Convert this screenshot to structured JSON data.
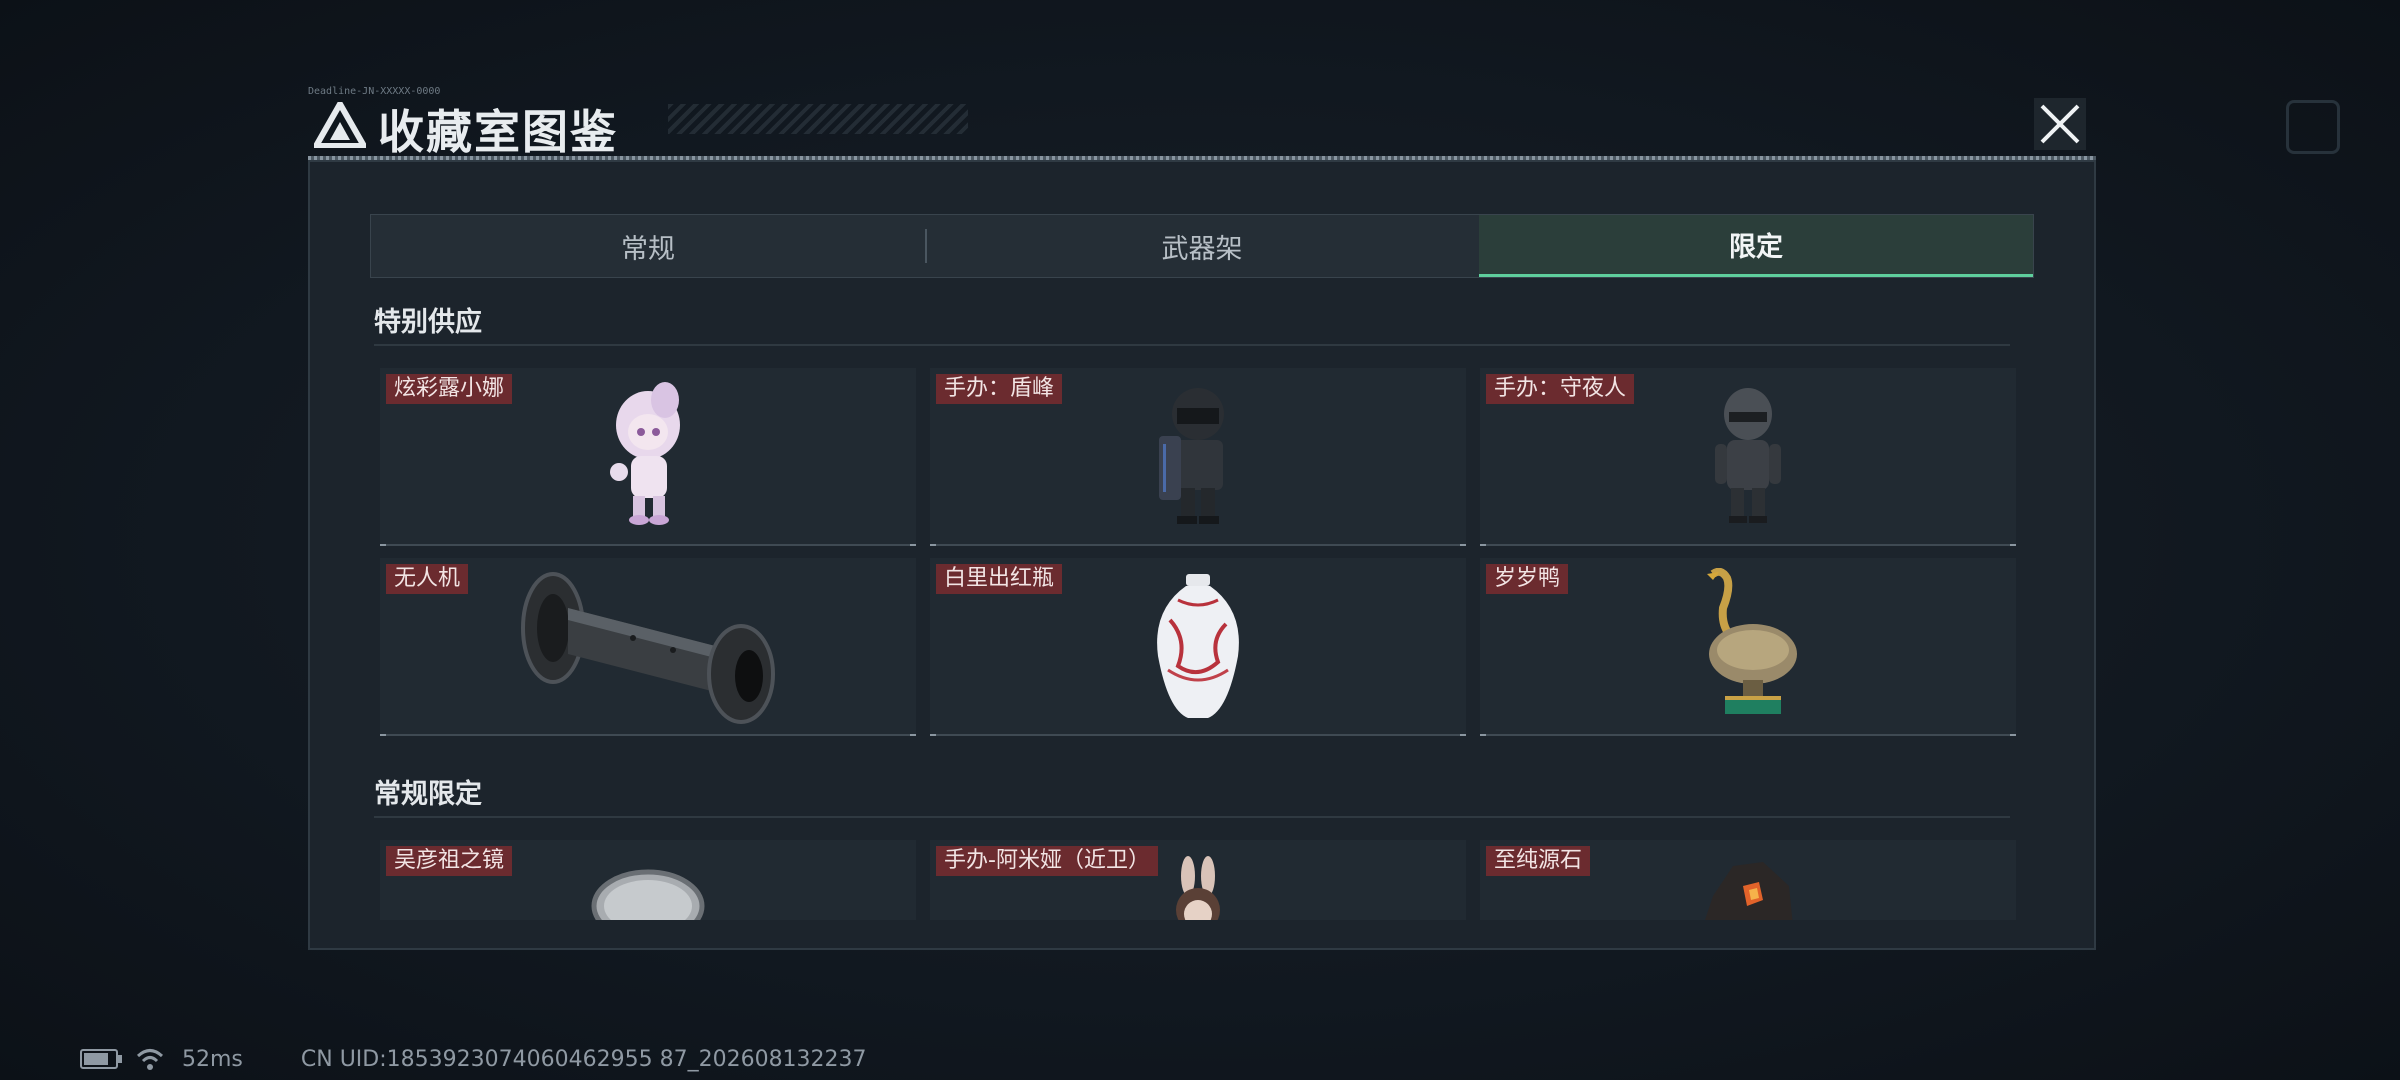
{
  "modal": {
    "title": "收藏室图鉴",
    "subcode": "Deadline-JN-XXXXX-0000",
    "close_icon": "close-icon"
  },
  "tabs": [
    {
      "label": "常规",
      "active": false
    },
    {
      "label": "武器架",
      "active": false
    },
    {
      "label": "限定",
      "active": true
    }
  ],
  "sections": [
    {
      "title": "特别供应",
      "items": [
        {
          "label": "炫彩露小娜",
          "art": "figure-girl"
        },
        {
          "label": "手办：盾峰",
          "art": "figure-shield-soldier"
        },
        {
          "label": "手办：守夜人",
          "art": "figure-night-watch"
        },
        {
          "label": "无人机",
          "art": "drone-roller"
        },
        {
          "label": "白里出红瓶",
          "art": "porcelain-vase"
        },
        {
          "label": "岁岁鸭",
          "art": "bronze-duck"
        }
      ]
    },
    {
      "title": "常规限定",
      "items": [
        {
          "label": "吴彦祖之镜",
          "art": "mirror"
        },
        {
          "label": "手办-阿米娅（近卫）",
          "art": "figure-rabbit"
        },
        {
          "label": "至纯源石",
          "art": "crystal-stone"
        }
      ]
    }
  ],
  "status": {
    "ping": "52ms",
    "uid": "CN UID:1853923074060462955 87_202608132237"
  },
  "colors": {
    "accent": "#5fcf9d",
    "label_bg": "#6b2b2f",
    "panel": "#1c242c"
  }
}
